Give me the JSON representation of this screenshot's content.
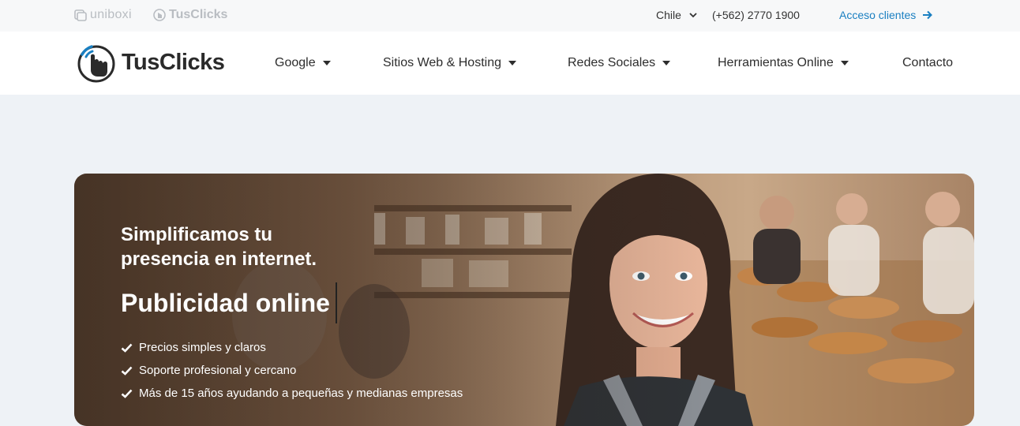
{
  "topbar": {
    "brands": [
      {
        "label": "uniboxi",
        "icon": "uniboxi-logo-icon"
      },
      {
        "label": "TusClicks",
        "icon": "tusclicks-mini-icon"
      }
    ],
    "country": "Chile",
    "phone": "(+562) 2770 1900",
    "access_label": "Acceso clientes"
  },
  "nav": {
    "logo_text": "TusClicks",
    "items": [
      {
        "label": "Google",
        "dropdown": true
      },
      {
        "label": "Sitios Web & Hosting",
        "dropdown": true
      },
      {
        "label": "Redes Sociales",
        "dropdown": true
      },
      {
        "label": "Herramientas Online",
        "dropdown": true
      },
      {
        "label": "Contacto",
        "dropdown": false
      }
    ]
  },
  "hero": {
    "subtitle_line1": "Simplificamos tu",
    "subtitle_line2": "presencia en internet.",
    "title": "Publicidad online",
    "features": [
      "Precios simples y claros",
      "Soporte profesional y cercano",
      "Más de 15 años ayudando a pequeñas y medianas empresas"
    ]
  },
  "colors": {
    "accent": "#1a7fc1",
    "page_bg": "#eef2f6",
    "topbar_bg": "#f7f8f9",
    "nav_bg": "#ffffff"
  }
}
